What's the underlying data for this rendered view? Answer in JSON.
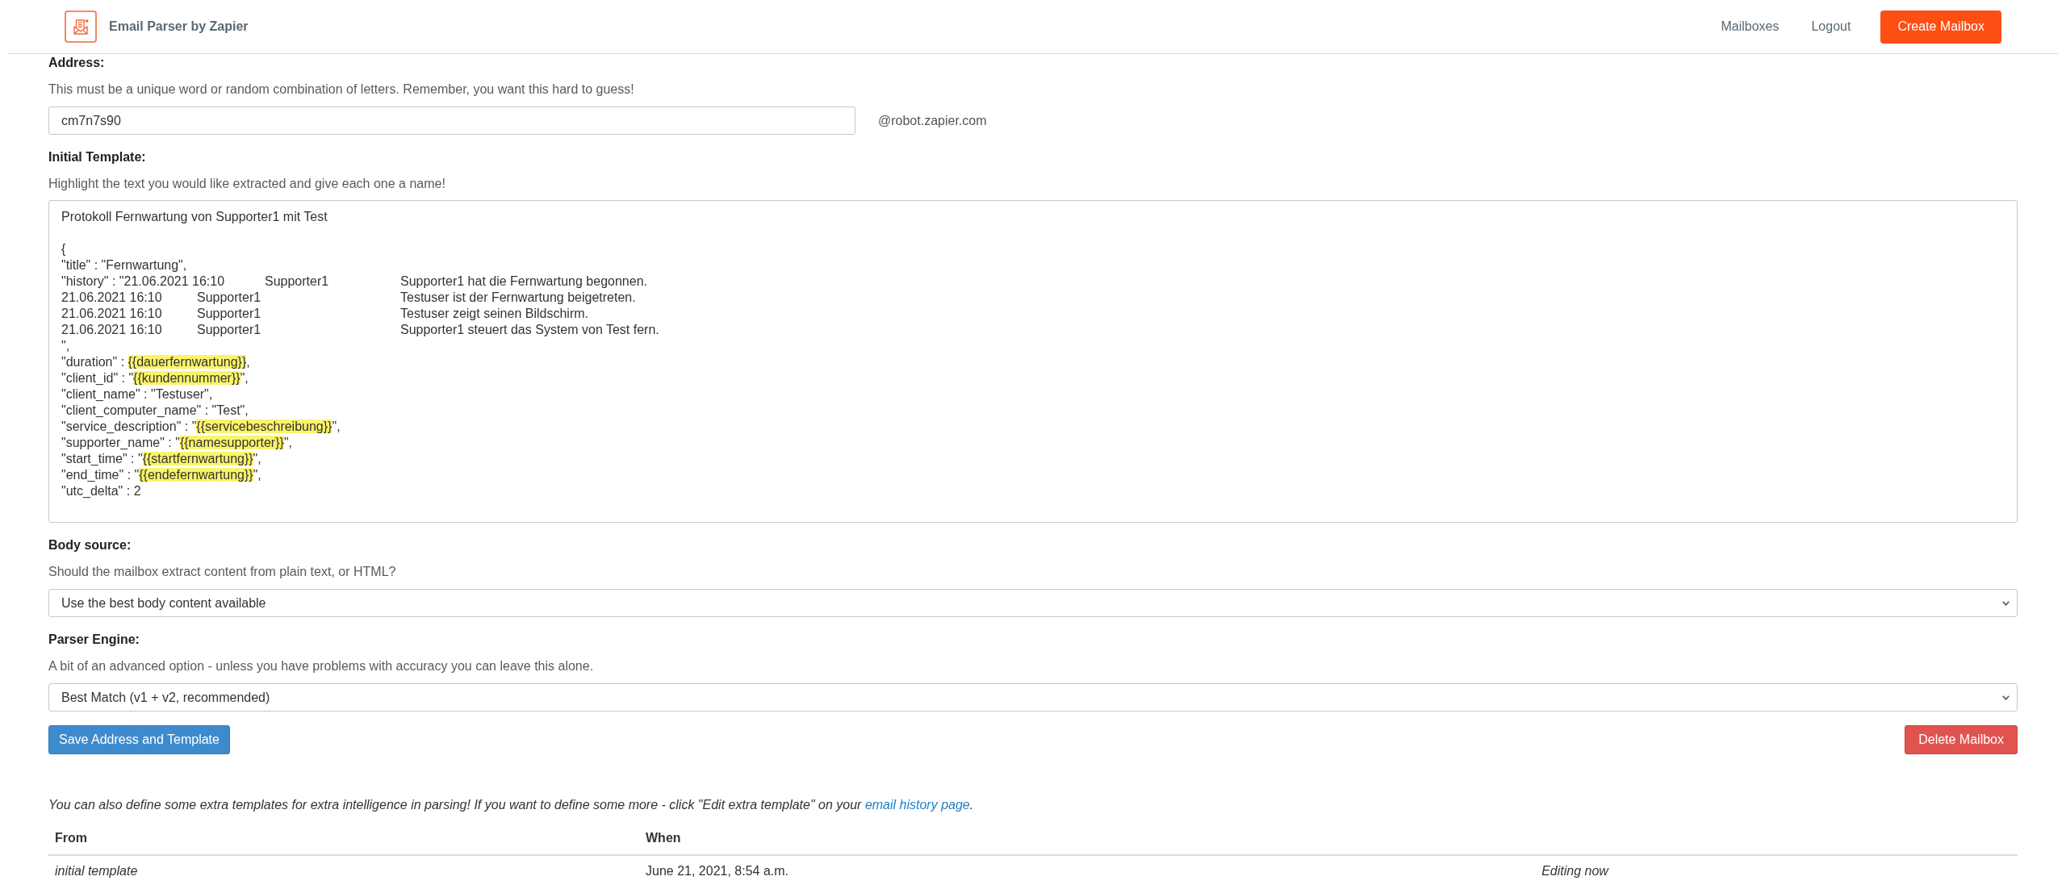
{
  "header": {
    "title": "Email Parser by Zapier",
    "nav": [
      "Mailboxes",
      "Logout"
    ],
    "action_button": "Create Mailbox"
  },
  "address": {
    "label": "Address:",
    "help": "This must be a unique word or random combination of letters. Remember, you want this hard to guess!",
    "value": "cm7n7s90",
    "domain": "@robot.zapier.com"
  },
  "template": {
    "label": "Initial Template:",
    "help": "Highlight the text you would like extracted and give each one a name!",
    "subject_line": "Protokoll Fernwartung von Supporter1 mit Test",
    "lines": [
      [
        {
          "text": "{",
          "highlighted": false
        }
      ],
      [
        {
          "text": "\"title\" : \"Fernwartung\",",
          "highlighted": false
        }
      ],
      [
        {
          "text": "\"history\" : \"21.06.2021 16:10\tSupporter1\t\tSupporter1 hat die Fernwartung begonnen.",
          "highlighted": false
        }
      ],
      [
        {
          "text": "21.06.2021 16:10\tSupporter1\t\t\tTestuser ist der Fernwartung beigetreten.",
          "highlighted": false
        }
      ],
      [
        {
          "text": "21.06.2021 16:10\tSupporter1\t\t\tTestuser zeigt seinen Bildschirm.",
          "highlighted": false
        }
      ],
      [
        {
          "text": "21.06.2021 16:10\tSupporter1\t\t\tSupporter1 steuert das System von Test fern.",
          "highlighted": false
        }
      ],
      [
        {
          "text": "\",",
          "highlighted": false
        }
      ],
      [
        {
          "text": "\"duration\" : ",
          "highlighted": false
        },
        {
          "text": "{{dauerfernwartung}}",
          "highlighted": true
        },
        {
          "text": ",",
          "highlighted": false
        }
      ],
      [
        {
          "text": "\"client_id\" : \"",
          "highlighted": false
        },
        {
          "text": "{{kundennummer}}",
          "highlighted": true
        },
        {
          "text": "\",",
          "highlighted": false
        }
      ],
      [
        {
          "text": "\"client_name\" : \"Testuser\",",
          "highlighted": false
        }
      ],
      [
        {
          "text": "\"client_computer_name\" : \"Test\",",
          "highlighted": false
        }
      ],
      [
        {
          "text": "\"service_description\" : \"",
          "highlighted": false
        },
        {
          "text": "{{servicebeschreibung}}",
          "highlighted": true
        },
        {
          "text": "\",",
          "highlighted": false
        }
      ],
      [
        {
          "text": "\"supporter_name\" : \"",
          "highlighted": false
        },
        {
          "text": "{{namesupporter}}",
          "highlighted": true
        },
        {
          "text": "\",",
          "highlighted": false
        }
      ],
      [
        {
          "text": "\"start_time\" : \"",
          "highlighted": false
        },
        {
          "text": "{{startfernwartung}}",
          "highlighted": true
        },
        {
          "text": "\",",
          "highlighted": false
        }
      ],
      [
        {
          "text": "\"end_time\" : \"",
          "highlighted": false
        },
        {
          "text": "{{endefernwartung}}",
          "highlighted": true
        },
        {
          "text": "\",",
          "highlighted": false
        }
      ],
      [
        {
          "text": "\"utc_delta\" : 2",
          "highlighted": false
        }
      ]
    ]
  },
  "body_source": {
    "label": "Body source:",
    "help": "Should the mailbox extract content from plain text, or HTML?",
    "value": "Use the best body content available"
  },
  "parser_engine": {
    "label": "Parser Engine:",
    "help": "A bit of an advanced option - unless you have problems with accuracy you can leave this alone.",
    "value": "Best Match (v1 + v2, recommended)"
  },
  "buttons": {
    "save": "Save Address and Template",
    "delete": "Delete Mailbox"
  },
  "extra_templates_note": {
    "text": "You can also define some extra templates for extra intelligence in parsing! If you want to define some more - click \"Edit extra template\" on your ",
    "link": "email history page",
    "text_after": "."
  },
  "table": {
    "columns": [
      "From",
      "When"
    ],
    "rows": [
      {
        "from": "initial template",
        "when": "June 21, 2021, 8:54 a.m.",
        "column_3": "Editing now"
      }
    ]
  }
}
